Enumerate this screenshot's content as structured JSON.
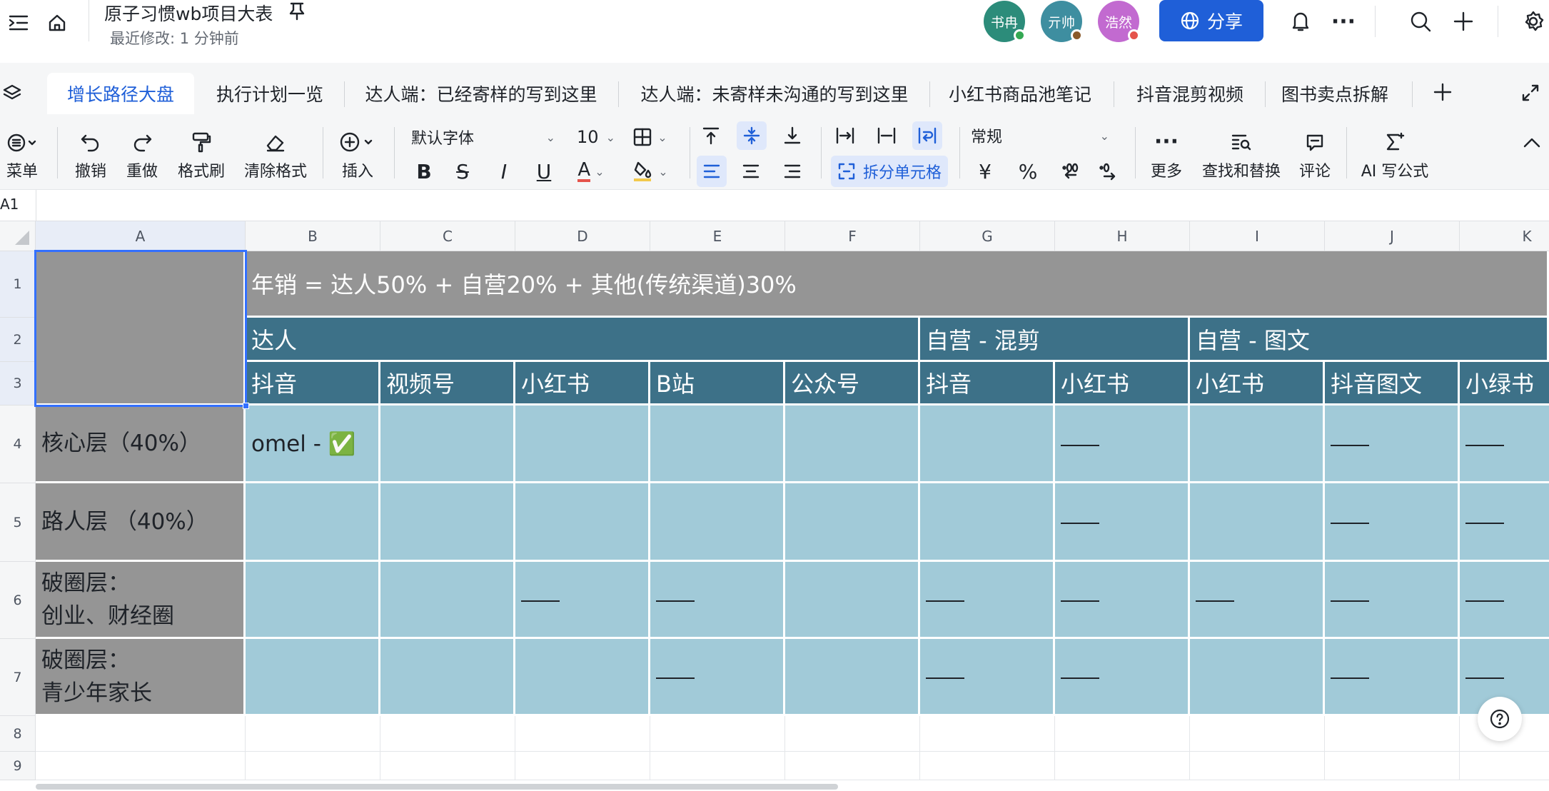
{
  "header": {
    "doc_title": "原子习惯wb项目大表",
    "last_modified": "最近修改: 1 分钟前",
    "avatars": [
      {
        "name": "书冉",
        "color": "#2c8c7a",
        "status": "#34a853"
      },
      {
        "name": "亓帅",
        "color": "#3e8ea0",
        "status": "#8a5a2b"
      },
      {
        "name": "浩然",
        "color": "#c26ad0",
        "status": "#e5534b"
      }
    ],
    "share_label": "分享"
  },
  "tabs": [
    {
      "label": "增长路径大盘",
      "active": true
    },
    {
      "label": "执行计划一览",
      "active": false
    },
    {
      "label": "达人端：已经寄样的写到这里",
      "active": false
    },
    {
      "label": "达人端：未寄样未沟通的写到这里",
      "active": false
    },
    {
      "label": "小红书商品池笔记",
      "active": false
    },
    {
      "label": "抖音混剪视频",
      "active": false
    },
    {
      "label": "图书卖点拆解",
      "active": false
    }
  ],
  "toolbar": {
    "menu": "菜单",
    "undo": "撤销",
    "redo": "重做",
    "format_painter": "格式刷",
    "clear_format": "清除格式",
    "insert": "插入",
    "font_family": "默认字体",
    "font_size": "10",
    "split_cells": "拆分单元格",
    "number_format": "常规",
    "currency": "¥",
    "percent": "%",
    "more": "更多",
    "find_replace": "查找和替换",
    "comment": "评论",
    "ai_formula": "AI 写公式"
  },
  "formula_bar": {
    "cell_ref": "A1"
  },
  "sheet": {
    "columns": [
      "A",
      "B",
      "C",
      "D",
      "E",
      "F",
      "G",
      "H",
      "I",
      "J",
      "K"
    ],
    "rows": [
      "1",
      "2",
      "3",
      "4",
      "5",
      "6",
      "7",
      "8",
      "9"
    ],
    "title_row": "年销 = 达人50% + 自营20% + 其他(传统渠道)30%",
    "groups": [
      "达人",
      "自营 - 混剪",
      "自营 - 图文"
    ],
    "subheaders": [
      "抖音",
      "视频号",
      "小红书",
      "B站",
      "公众号",
      "抖音",
      "小红书",
      "小红书",
      "抖音图文",
      "小绿书"
    ],
    "row_labels": [
      [
        "核心层（40%）"
      ],
      [
        "路人层 （40%）"
      ],
      [
        "破圈层：",
        "创业、财经圈"
      ],
      [
        "破圈层：",
        "青少年家长"
      ]
    ],
    "cell_b4": "omel - ✅"
  }
}
